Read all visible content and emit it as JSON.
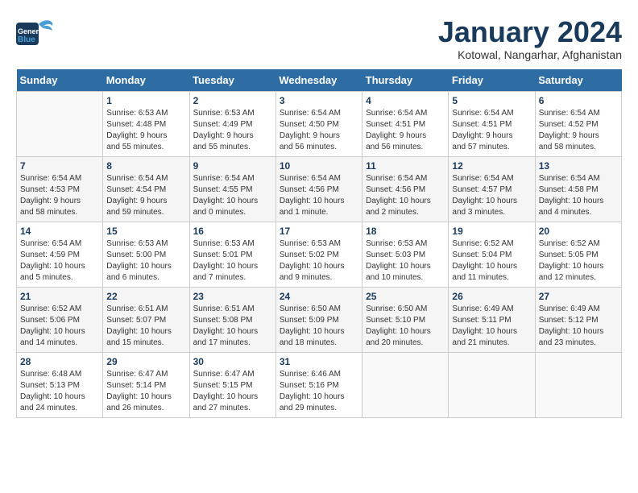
{
  "logo": {
    "general": "General",
    "blue": "Blue"
  },
  "header": {
    "month": "January 2024",
    "location": "Kotowal, Nangarhar, Afghanistan"
  },
  "days_of_week": [
    "Sunday",
    "Monday",
    "Tuesday",
    "Wednesday",
    "Thursday",
    "Friday",
    "Saturday"
  ],
  "weeks": [
    [
      {
        "day": "",
        "info": ""
      },
      {
        "day": "1",
        "info": "Sunrise: 6:53 AM\nSunset: 4:48 PM\nDaylight: 9 hours\nand 55 minutes."
      },
      {
        "day": "2",
        "info": "Sunrise: 6:53 AM\nSunset: 4:49 PM\nDaylight: 9 hours\nand 55 minutes."
      },
      {
        "day": "3",
        "info": "Sunrise: 6:54 AM\nSunset: 4:50 PM\nDaylight: 9 hours\nand 56 minutes."
      },
      {
        "day": "4",
        "info": "Sunrise: 6:54 AM\nSunset: 4:51 PM\nDaylight: 9 hours\nand 56 minutes."
      },
      {
        "day": "5",
        "info": "Sunrise: 6:54 AM\nSunset: 4:51 PM\nDaylight: 9 hours\nand 57 minutes."
      },
      {
        "day": "6",
        "info": "Sunrise: 6:54 AM\nSunset: 4:52 PM\nDaylight: 9 hours\nand 58 minutes."
      }
    ],
    [
      {
        "day": "7",
        "info": "Sunrise: 6:54 AM\nSunset: 4:53 PM\nDaylight: 9 hours\nand 58 minutes."
      },
      {
        "day": "8",
        "info": "Sunrise: 6:54 AM\nSunset: 4:54 PM\nDaylight: 9 hours\nand 59 minutes."
      },
      {
        "day": "9",
        "info": "Sunrise: 6:54 AM\nSunset: 4:55 PM\nDaylight: 10 hours\nand 0 minutes."
      },
      {
        "day": "10",
        "info": "Sunrise: 6:54 AM\nSunset: 4:56 PM\nDaylight: 10 hours\nand 1 minute."
      },
      {
        "day": "11",
        "info": "Sunrise: 6:54 AM\nSunset: 4:56 PM\nDaylight: 10 hours\nand 2 minutes."
      },
      {
        "day": "12",
        "info": "Sunrise: 6:54 AM\nSunset: 4:57 PM\nDaylight: 10 hours\nand 3 minutes."
      },
      {
        "day": "13",
        "info": "Sunrise: 6:54 AM\nSunset: 4:58 PM\nDaylight: 10 hours\nand 4 minutes."
      }
    ],
    [
      {
        "day": "14",
        "info": "Sunrise: 6:54 AM\nSunset: 4:59 PM\nDaylight: 10 hours\nand 5 minutes."
      },
      {
        "day": "15",
        "info": "Sunrise: 6:53 AM\nSunset: 5:00 PM\nDaylight: 10 hours\nand 6 minutes."
      },
      {
        "day": "16",
        "info": "Sunrise: 6:53 AM\nSunset: 5:01 PM\nDaylight: 10 hours\nand 7 minutes."
      },
      {
        "day": "17",
        "info": "Sunrise: 6:53 AM\nSunset: 5:02 PM\nDaylight: 10 hours\nand 9 minutes."
      },
      {
        "day": "18",
        "info": "Sunrise: 6:53 AM\nSunset: 5:03 PM\nDaylight: 10 hours\nand 10 minutes."
      },
      {
        "day": "19",
        "info": "Sunrise: 6:52 AM\nSunset: 5:04 PM\nDaylight: 10 hours\nand 11 minutes."
      },
      {
        "day": "20",
        "info": "Sunrise: 6:52 AM\nSunset: 5:05 PM\nDaylight: 10 hours\nand 12 minutes."
      }
    ],
    [
      {
        "day": "21",
        "info": "Sunrise: 6:52 AM\nSunset: 5:06 PM\nDaylight: 10 hours\nand 14 minutes."
      },
      {
        "day": "22",
        "info": "Sunrise: 6:51 AM\nSunset: 5:07 PM\nDaylight: 10 hours\nand 15 minutes."
      },
      {
        "day": "23",
        "info": "Sunrise: 6:51 AM\nSunset: 5:08 PM\nDaylight: 10 hours\nand 17 minutes."
      },
      {
        "day": "24",
        "info": "Sunrise: 6:50 AM\nSunset: 5:09 PM\nDaylight: 10 hours\nand 18 minutes."
      },
      {
        "day": "25",
        "info": "Sunrise: 6:50 AM\nSunset: 5:10 PM\nDaylight: 10 hours\nand 20 minutes."
      },
      {
        "day": "26",
        "info": "Sunrise: 6:49 AM\nSunset: 5:11 PM\nDaylight: 10 hours\nand 21 minutes."
      },
      {
        "day": "27",
        "info": "Sunrise: 6:49 AM\nSunset: 5:12 PM\nDaylight: 10 hours\nand 23 minutes."
      }
    ],
    [
      {
        "day": "28",
        "info": "Sunrise: 6:48 AM\nSunset: 5:13 PM\nDaylight: 10 hours\nand 24 minutes."
      },
      {
        "day": "29",
        "info": "Sunrise: 6:47 AM\nSunset: 5:14 PM\nDaylight: 10 hours\nand 26 minutes."
      },
      {
        "day": "30",
        "info": "Sunrise: 6:47 AM\nSunset: 5:15 PM\nDaylight: 10 hours\nand 27 minutes."
      },
      {
        "day": "31",
        "info": "Sunrise: 6:46 AM\nSunset: 5:16 PM\nDaylight: 10 hours\nand 29 minutes."
      },
      {
        "day": "",
        "info": ""
      },
      {
        "day": "",
        "info": ""
      },
      {
        "day": "",
        "info": ""
      }
    ]
  ]
}
